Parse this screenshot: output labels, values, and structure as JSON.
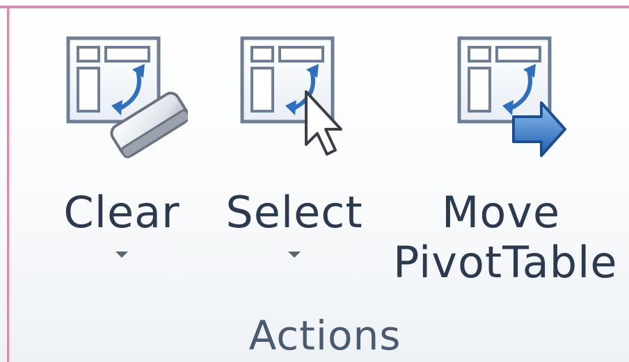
{
  "group": {
    "label": "Actions"
  },
  "buttons": {
    "clear": {
      "label": "Clear",
      "icon": "pivottable-eraser-icon",
      "has_dropdown": true
    },
    "select": {
      "label": "Select",
      "icon": "pivottable-select-cursor-icon",
      "has_dropdown": true
    },
    "move": {
      "label_line1": "Move",
      "label_line2": "PivotTable",
      "icon": "pivottable-move-arrow-icon",
      "has_dropdown": false
    }
  },
  "colors": {
    "group_border": "#d98ab0",
    "label_text": "#2b3a4e",
    "icon_blue": "#2f6fbf"
  }
}
